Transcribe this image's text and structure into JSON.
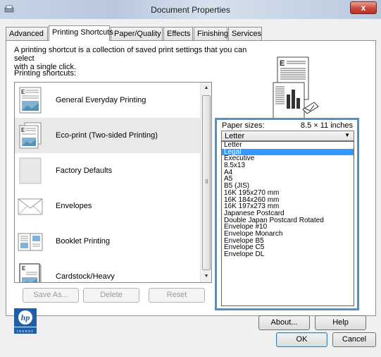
{
  "window": {
    "title": "Document Properties",
    "close_glyph": "x"
  },
  "tabs": [
    {
      "label": "Advanced",
      "active": false
    },
    {
      "label": "Printing Shortcuts",
      "active": true
    },
    {
      "label": "Paper/Quality",
      "active": false
    },
    {
      "label": "Effects",
      "active": false
    },
    {
      "label": "Finishing",
      "active": false
    },
    {
      "label": "Services",
      "active": false
    }
  ],
  "description_line1": "A printing shortcut is a collection of saved print settings that you can select",
  "description_line2": "with a single click.",
  "shortcuts_label": "Printing shortcuts:",
  "shortcuts": [
    {
      "label": "General Everyday Printing",
      "icon": "general-doc-icon",
      "selected": false
    },
    {
      "label": "Eco-print (Two-sided Printing)",
      "icon": "duplex-doc-icon",
      "selected": true
    },
    {
      "label": "Factory Defaults",
      "icon": "blank-doc-icon",
      "selected": false
    },
    {
      "label": "Envelopes",
      "icon": "envelope-icon",
      "selected": false
    },
    {
      "label": "Booklet Printing",
      "icon": "booklet-icon",
      "selected": false
    },
    {
      "label": "Cardstock/Heavy",
      "icon": "cardstock-icon",
      "selected": false
    }
  ],
  "buttons": {
    "save_as": "Save As...",
    "delete": "Delete",
    "reset": "Reset",
    "about": "About...",
    "help": "Help",
    "ok": "OK",
    "cancel": "Cancel"
  },
  "paper": {
    "label": "Paper sizes:",
    "current_size": "8.5 × 11 inches",
    "selected_value": "Letter",
    "highlighted_option": "Legal",
    "options": [
      "Letter",
      "Legal",
      "Executive",
      "8.5x13",
      "A4",
      "A5",
      "B5 (JIS)",
      "16K 195x270 mm",
      "16K 184x260 mm",
      "16K 197x273 mm",
      "Japanese Postcard",
      "Double Japan Postcard Rotated",
      "Envelope #10",
      "Envelope Monarch",
      "Envelope B5",
      "Envelope C5",
      "Envelope DL"
    ]
  },
  "logo": {
    "brand": "hp",
    "tagline": "invent"
  },
  "colors": {
    "highlight": "#3399ff",
    "callout_border": "#4b95c6",
    "hp_blue": "#1f5fa9"
  }
}
